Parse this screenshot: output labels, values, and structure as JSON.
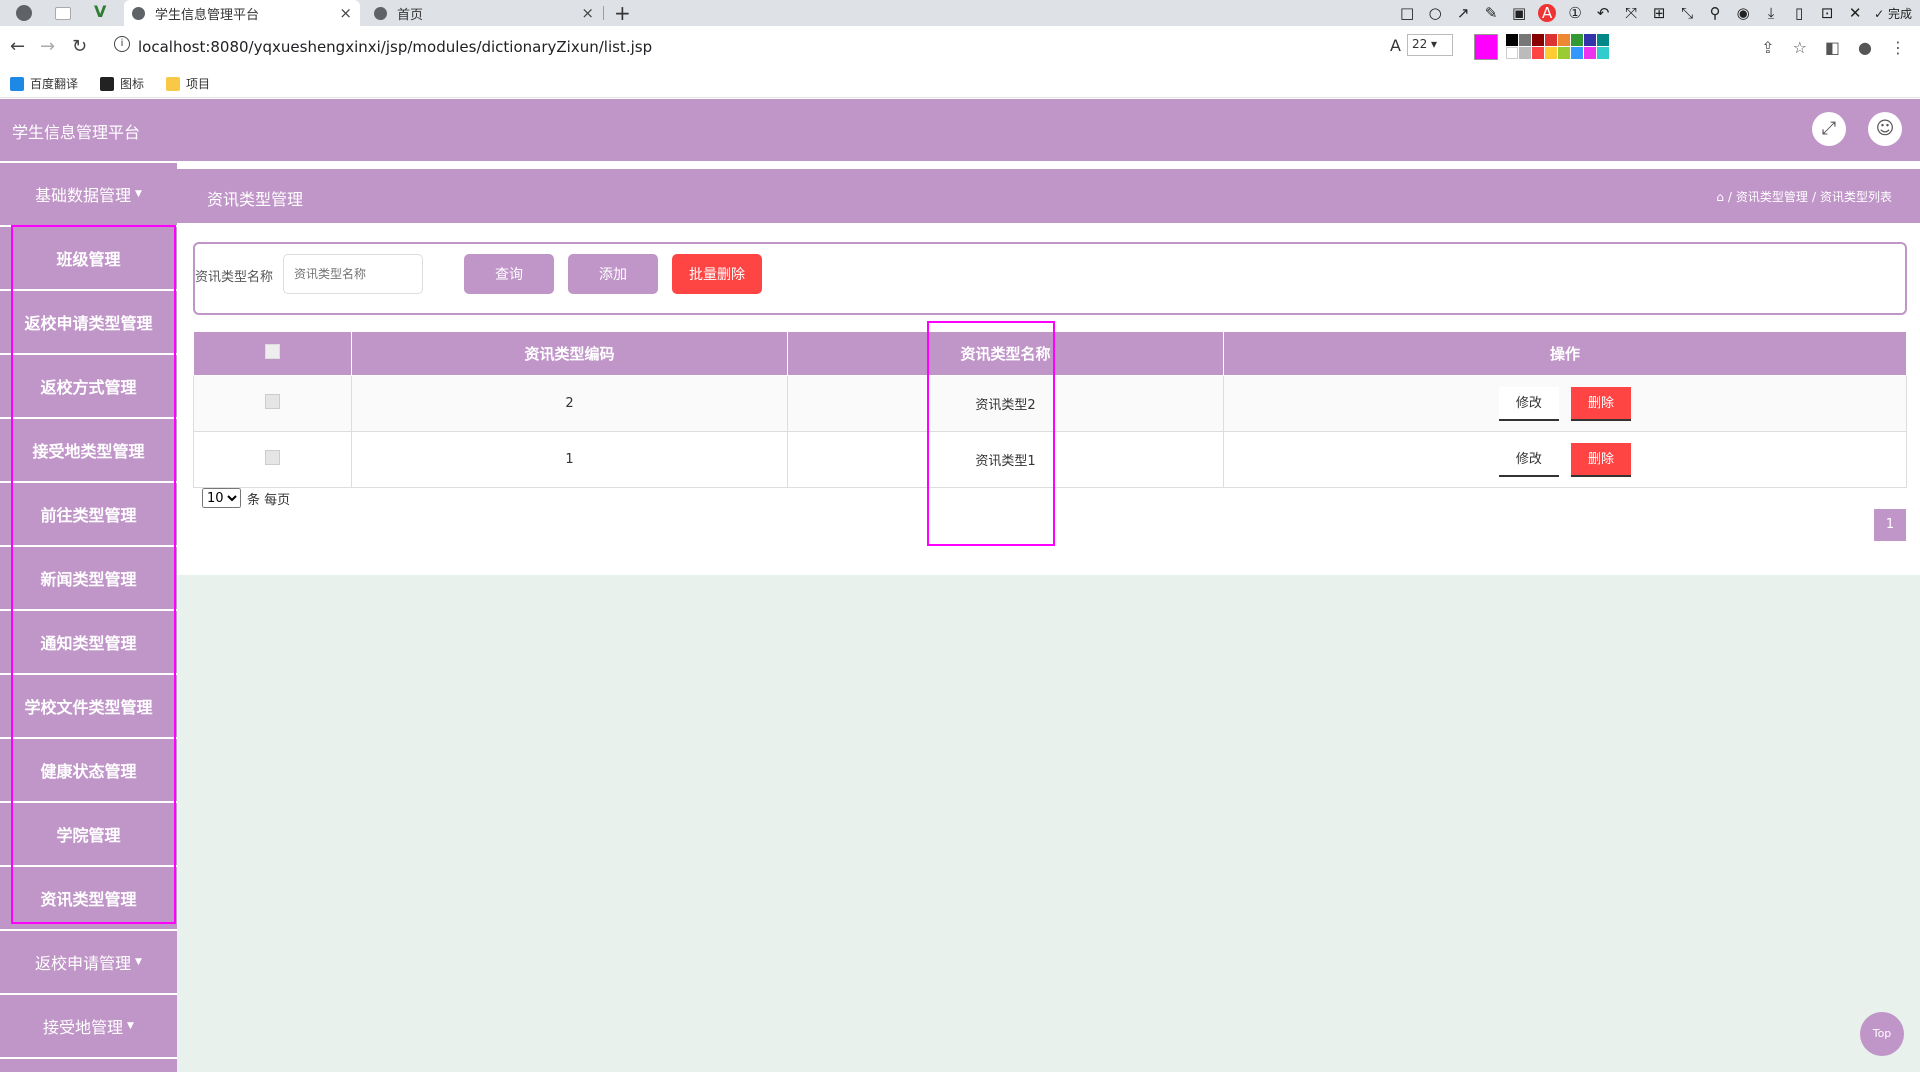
{
  "browser": {
    "tabs": [
      {
        "title": "学生信息管理平台"
      },
      {
        "title": "首页"
      }
    ],
    "url": "localhost:8080/yqxueshengxinxi/jsp/modules/dictionaryZixun/list.jsp",
    "font_size_value": "22",
    "toolbar_done_label": "完成",
    "bookmarks": [
      "百度翻译",
      "图标",
      "项目"
    ]
  },
  "app": {
    "title": "学生信息管理平台"
  },
  "sidebar": {
    "group_top": "基础数据管理",
    "items": [
      "班级管理",
      "返校申请类型管理",
      "返校方式管理",
      "接受地类型管理",
      "前往类型管理",
      "新闻类型管理",
      "通知类型管理",
      "学校文件类型管理",
      "健康状态管理",
      "学院管理",
      "资讯类型管理"
    ],
    "group_bottom_1": "返校申请管理",
    "group_bottom_2": "接受地管理"
  },
  "page": {
    "title": "资讯类型管理",
    "breadcrumb": [
      "资讯类型管理",
      "资讯类型列表"
    ]
  },
  "search": {
    "label": "资讯类型名称",
    "placeholder": "资讯类型名称",
    "query_label": "查询",
    "add_label": "添加",
    "batch_delete_label": "批量删除"
  },
  "table": {
    "headers": [
      "资讯类型编码",
      "资讯类型名称",
      "操作"
    ],
    "rows": [
      {
        "code": "2",
        "name": "资讯类型2"
      },
      {
        "code": "1",
        "name": "资讯类型1"
      }
    ],
    "edit_label": "修改",
    "delete_label": "删除"
  },
  "pager": {
    "page_size": "10",
    "per_page_label": "条 每页",
    "current_page": "1"
  },
  "top_button": "Top",
  "colors": {
    "primary": "#c095c8",
    "danger": "#ff4444",
    "annotation": "#ff00ff",
    "main_bg": "#e8f1ec"
  }
}
